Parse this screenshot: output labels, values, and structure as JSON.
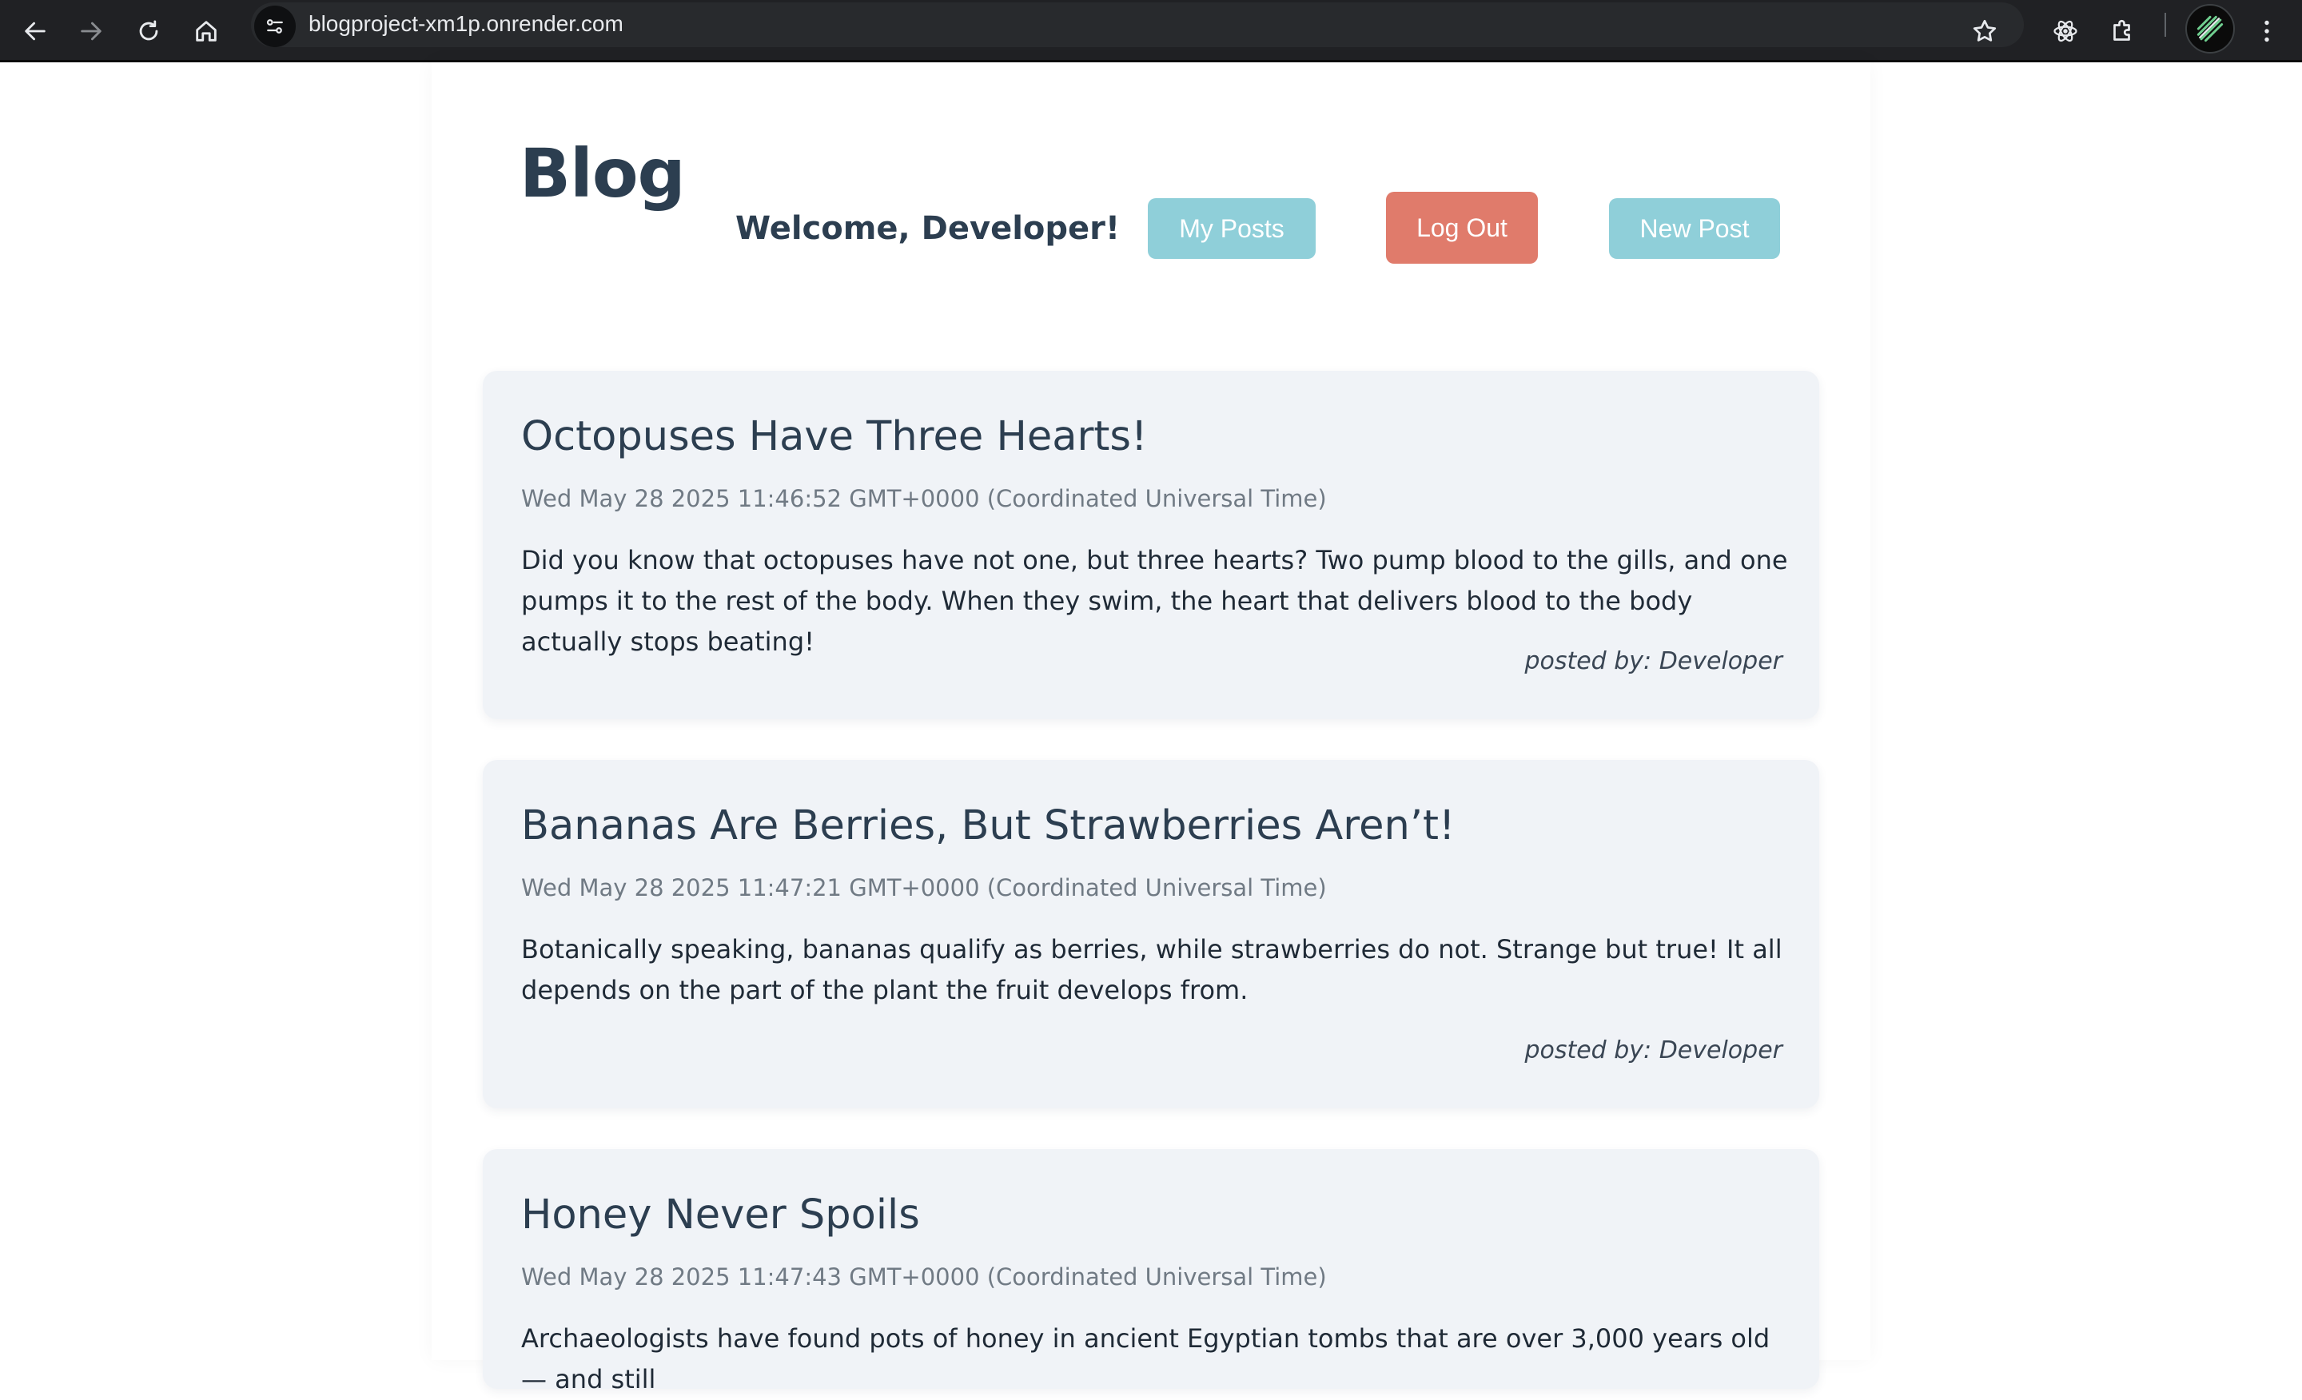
{
  "browser": {
    "url": "blogproject-xm1p.onrender.com"
  },
  "header": {
    "brand": "Blog",
    "welcome": "Welcome, Developer!",
    "my_posts_label": "My Posts",
    "logout_label": "Log Out",
    "new_post_label": "New Post"
  },
  "colors": {
    "primary_button": "#8fcfd9",
    "danger_button": "#e07b6b",
    "card_background": "#f0f3f7",
    "heading_text": "#2c3e50"
  },
  "posts": [
    {
      "title": "Octopuses Have Three Hearts!",
      "date": "Wed May 28 2025 11:46:52 GMT+0000 (Coordinated Universal Time)",
      "body": "Did you know that octopuses have not one, but three hearts? Two pump blood to the gills, and one pumps it to the rest of the body. When they swim, the heart that delivers blood to the body actually stops beating!",
      "author": "posted by: Developer"
    },
    {
      "title": "Bananas Are Berries, But Strawberries Aren’t!",
      "date": "Wed May 28 2025 11:47:21 GMT+0000 (Coordinated Universal Time)",
      "body": "Botanically speaking, bananas qualify as berries, while strawberries do not. Strange but true! It all depends on the part of the plant the fruit develops from.",
      "author": "posted by: Developer"
    },
    {
      "title": "Honey Never Spoils",
      "date": "Wed May 28 2025 11:47:43 GMT+0000 (Coordinated Universal Time)",
      "body": "Archaeologists have found pots of honey in ancient Egyptian tombs that are over 3,000 years old — and still",
      "author": ""
    }
  ]
}
